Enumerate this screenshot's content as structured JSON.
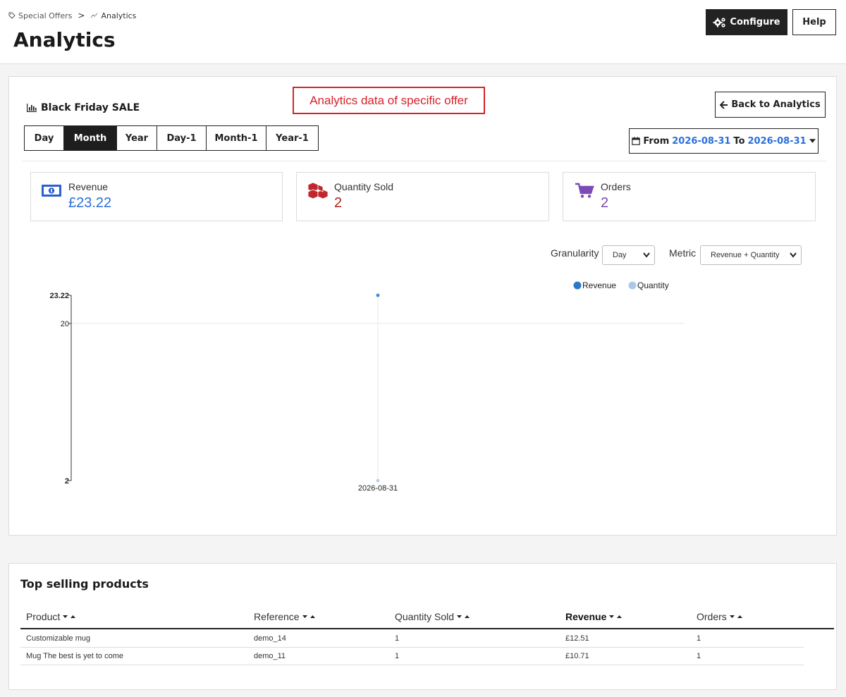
{
  "breadcrumb": {
    "parent": "Special Offers",
    "current": "Analytics"
  },
  "page_title": "Analytics",
  "header_buttons": {
    "configure": "Configure",
    "help": "Help"
  },
  "offer": {
    "title": "Black Friday SALE"
  },
  "annotation": "Analytics data of specific offer",
  "back_button": "Back to Analytics",
  "period_tabs": [
    "Day",
    "Month",
    "Year",
    "Day-1",
    "Month-1",
    "Year-1"
  ],
  "active_period": "Month",
  "date_range": {
    "from_label": "From",
    "from": "2026-08-31",
    "to_label": "To",
    "to": "2026-08-31"
  },
  "kpis": {
    "revenue": {
      "label": "Revenue",
      "value": "£23.22",
      "color": "#2a6fdb"
    },
    "quantity": {
      "label": "Quantity Sold",
      "value": "2",
      "color": "#b22222"
    },
    "orders": {
      "label": "Orders",
      "value": "2",
      "color": "#7b4ab5"
    }
  },
  "controls": {
    "granularity_label": "Granularity",
    "granularity_value": "Day",
    "metric_label": "Metric",
    "metric_value": "Revenue + Quantity"
  },
  "chart_data": {
    "type": "line",
    "x": [
      "2026-08-31"
    ],
    "series": [
      {
        "name": "Revenue",
        "values": [
          23.22
        ],
        "color": "#2b78c6"
      },
      {
        "name": "Quantity",
        "values": [
          2
        ],
        "color": "#aec7e8"
      }
    ],
    "y_ticks": [
      "23.22",
      "20",
      "2"
    ],
    "ylim": [
      2,
      23.22
    ],
    "grid": true,
    "legend": "top-right"
  },
  "table": {
    "title": "Top selling products",
    "columns": [
      "Product",
      "Reference",
      "Quantity Sold",
      "Revenue",
      "Orders"
    ],
    "sorted_column": "Revenue",
    "rows": [
      [
        "Customizable mug",
        "demo_14",
        "1",
        "£12.51",
        "1"
      ],
      [
        "Mug The best is yet to come",
        "demo_11",
        "1",
        "£10.71",
        "1"
      ]
    ]
  }
}
